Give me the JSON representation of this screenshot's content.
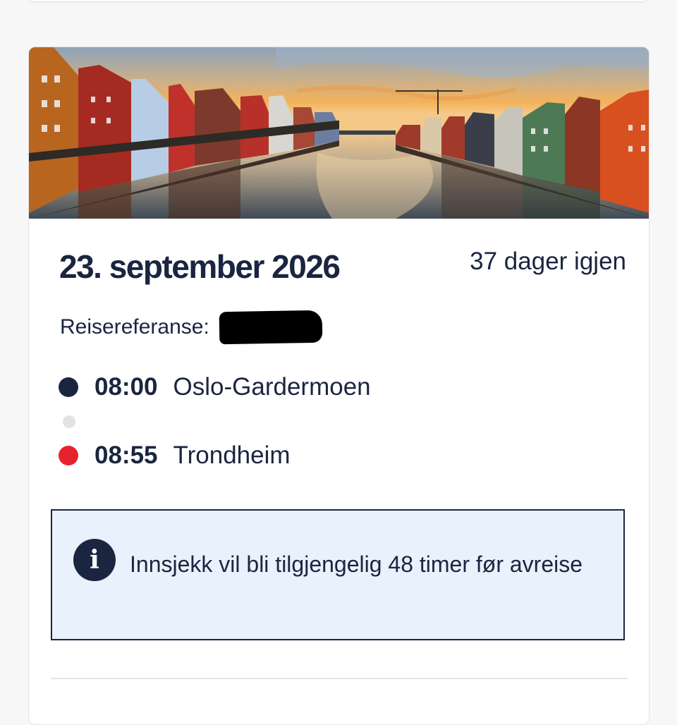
{
  "trip": {
    "date": "23. september 2026",
    "days_left": "37 dager igjen",
    "reference_label": "Reisereferanse:",
    "hero_image": "Trondheim Bryggen wharf houses along the river at sunset"
  },
  "itinerary": {
    "departure": {
      "time": "08:00",
      "place": "Oslo-Gardermoen",
      "dot_color": "#1a2540"
    },
    "arrival": {
      "time": "08:55",
      "place": "Trondheim",
      "dot_color": "#e8212e"
    }
  },
  "notice": {
    "icon": "info-icon",
    "text": "Innsjekk vil bli tilgjengelig 48 timer før avreise"
  },
  "colors": {
    "primary": "#1a2540",
    "accent_red": "#e8212e",
    "info_bg": "#e9f1fc"
  }
}
